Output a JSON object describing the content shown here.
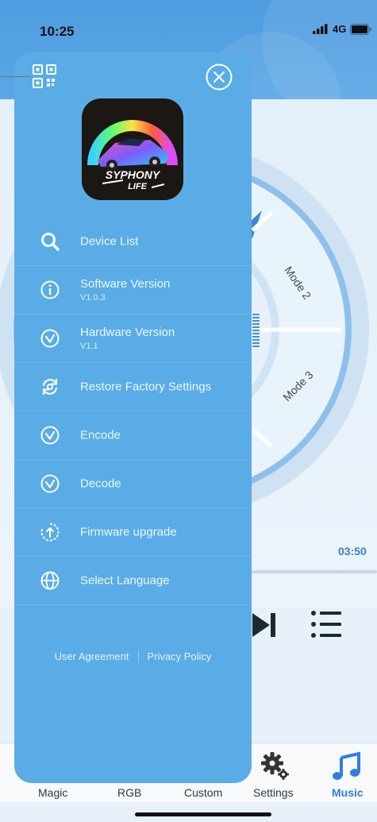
{
  "status_bar": {
    "time": "10:25",
    "network": "4G"
  },
  "drawer": {
    "logo_text_line1": "SYPHONY",
    "logo_text_line2": "LIFE",
    "menu": [
      {
        "id": "device-list",
        "icon": "search-icon",
        "title": "Device List",
        "subtitle": ""
      },
      {
        "id": "software-version",
        "icon": "info-icon",
        "title": "Software Version",
        "subtitle": "V1.0.3"
      },
      {
        "id": "hardware-version",
        "icon": "check-circle-icon",
        "title": "Hardware Version",
        "subtitle": "V1.1"
      },
      {
        "id": "restore-factory",
        "icon": "restore-icon",
        "title": "Restore Factory Settings",
        "subtitle": ""
      },
      {
        "id": "encode",
        "icon": "check-circle-icon",
        "title": "Encode",
        "subtitle": ""
      },
      {
        "id": "decode",
        "icon": "check-circle-icon",
        "title": "Decode",
        "subtitle": ""
      },
      {
        "id": "firmware-upgrade",
        "icon": "upload-circle-icon",
        "title": "Firmware upgrade",
        "subtitle": ""
      },
      {
        "id": "select-language",
        "icon": "globe-icon",
        "title": "Select Language",
        "subtitle": ""
      }
    ],
    "footer": {
      "user_agreement": "User Agreement",
      "privacy_policy": "Privacy Policy"
    }
  },
  "background": {
    "dial_modes": [
      "Mode 2",
      "Mode 3"
    ],
    "time_total": "03:50",
    "tabs": [
      {
        "label": "Magic",
        "active": false
      },
      {
        "label": "RGB",
        "active": false
      },
      {
        "label": "Custom",
        "active": false
      },
      {
        "label": "Settings",
        "active": false
      },
      {
        "label": "Music",
        "active": true
      }
    ]
  },
  "colors": {
    "drawer_bg": "#5aace6",
    "accent": "#2f7fe0",
    "header_bg": "#4f9ce0"
  }
}
